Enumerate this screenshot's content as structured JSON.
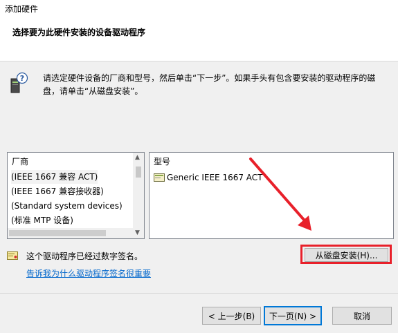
{
  "window": {
    "title": "添加硬件"
  },
  "header": {
    "subtitle": "选择要为此硬件安装的设备驱动程序"
  },
  "description": "请选定硬件设备的厂商和型号，然后单击“下一步”。如果手头有包含要安装的驱动程序的磁盘，请单击“从磁盘安装”。",
  "manufacturer_list": {
    "header": "厂商",
    "items": [
      "(IEEE 1667 兼容 ACT)",
      "(IEEE 1667 兼容接收器)",
      "(Standard system devices)",
      "(标准 MTP 设备)"
    ]
  },
  "model_list": {
    "header": "型号",
    "items": [
      "Generic IEEE 1667 ACT"
    ]
  },
  "signed_text": "这个驱动程序已经过数字签名。",
  "signing_link": "告诉我为什么驱动程序签名很重要",
  "buttons": {
    "have_disk": "从磁盘安装(H)...",
    "back": "< 上一步(B)",
    "next": "下一页(N) >",
    "cancel": "取消"
  },
  "colors": {
    "annotation": "#e8202a",
    "accent": "#0078d7",
    "link": "#0066cc"
  }
}
